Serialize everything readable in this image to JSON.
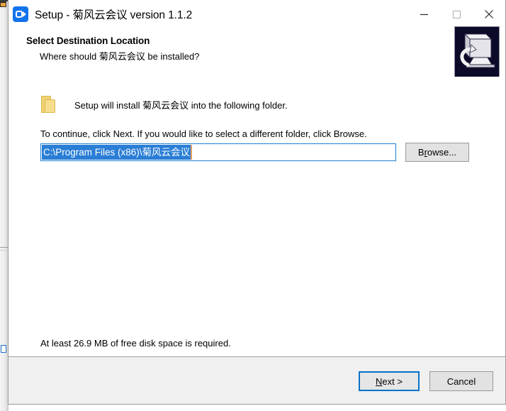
{
  "window": {
    "title": "Setup - 菊风云会议 version 1.1.2",
    "app_icon": "video-camera-icon",
    "controls": {
      "minimize": "minimize-icon",
      "maximize": "maximize-icon",
      "close": "close-icon"
    }
  },
  "header": {
    "title": "Select Destination Location",
    "subtitle": "Where should 菊风云会议 be installed?",
    "logo": "setup-computer-logo"
  },
  "body": {
    "folder_icon": "folder-icon",
    "install_text": "Setup will install 菊风云会议 into the following folder.",
    "continue_text": "To continue, click Next. If you would like to select a different folder, click Browse.",
    "path_input": {
      "value": "C:\\Program Files (x86)\\菊风云会议",
      "selected": true
    },
    "browse_button": {
      "prefix": "B",
      "accel": "r",
      "suffix": "owse..."
    },
    "diskspace_text": "At least 26.9 MB of free disk space is required."
  },
  "footer": {
    "next_button": {
      "prefix": "",
      "accel": "N",
      "suffix": "ext >"
    },
    "cancel_button": "Cancel"
  },
  "colors": {
    "accent_blue": "#1273eb",
    "selection_blue": "#2a7ed6",
    "focus_blue": "#0a71c8",
    "folder_yellow": "#f0d274",
    "footer_grey": "#f0f0f0",
    "logo_navy": "#0b0b29"
  }
}
